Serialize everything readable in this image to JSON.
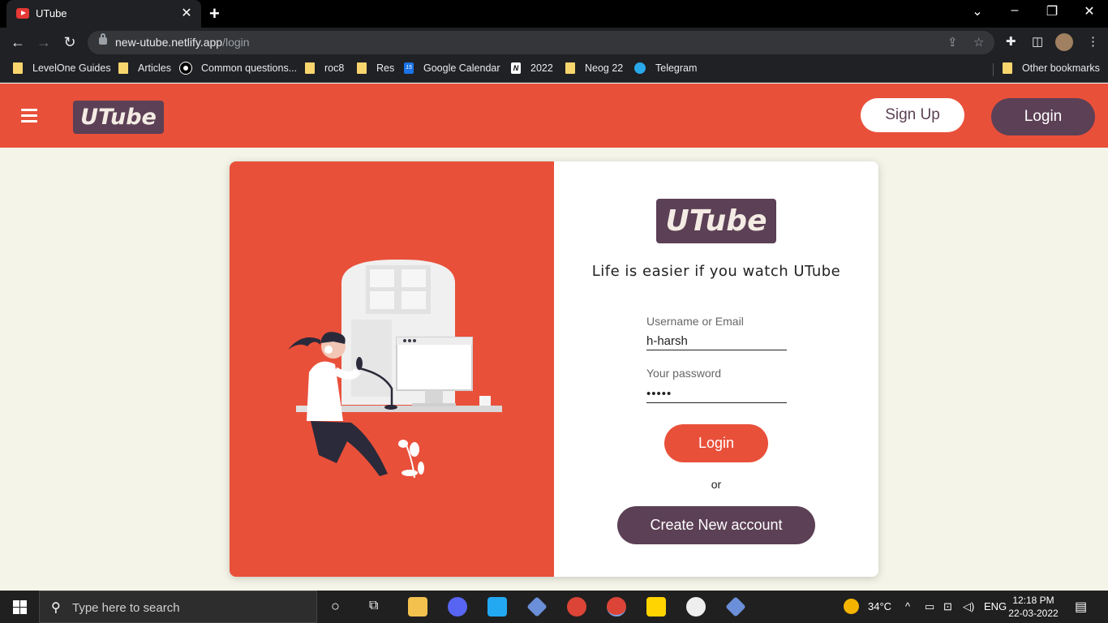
{
  "browser": {
    "tab_title": "UTube",
    "tab_close": "✕",
    "new_tab": "+",
    "url_host": "new-utube.netlify.app",
    "url_path": "/login",
    "bookmarks": [
      "LevelOne Guides",
      "Articles",
      "Common questions...",
      "roc8",
      "Res",
      "Google Calendar",
      "2022",
      "Neog 22",
      "Telegram"
    ],
    "other_bookmarks": "Other bookmarks"
  },
  "header": {
    "logo": "UTube",
    "signup_label": "Sign Up",
    "login_label": "Login"
  },
  "login_card": {
    "logo": "UTube",
    "tagline": "Life is easier if you watch UTube",
    "username_label": "Username or Email",
    "username_value": "h-harsh",
    "password_label": "Your password",
    "password_value": "•••••",
    "login_button": "Login",
    "or_text": "or",
    "create_button": "Create New account"
  },
  "taskbar": {
    "search_placeholder": "Type here to search",
    "temperature": "34°C",
    "language": "ENG",
    "time": "12:18 PM",
    "date": "22-03-2022"
  },
  "colors": {
    "primary": "#e9503a",
    "secondary": "#5c4055",
    "background": "#f4f4e8"
  }
}
